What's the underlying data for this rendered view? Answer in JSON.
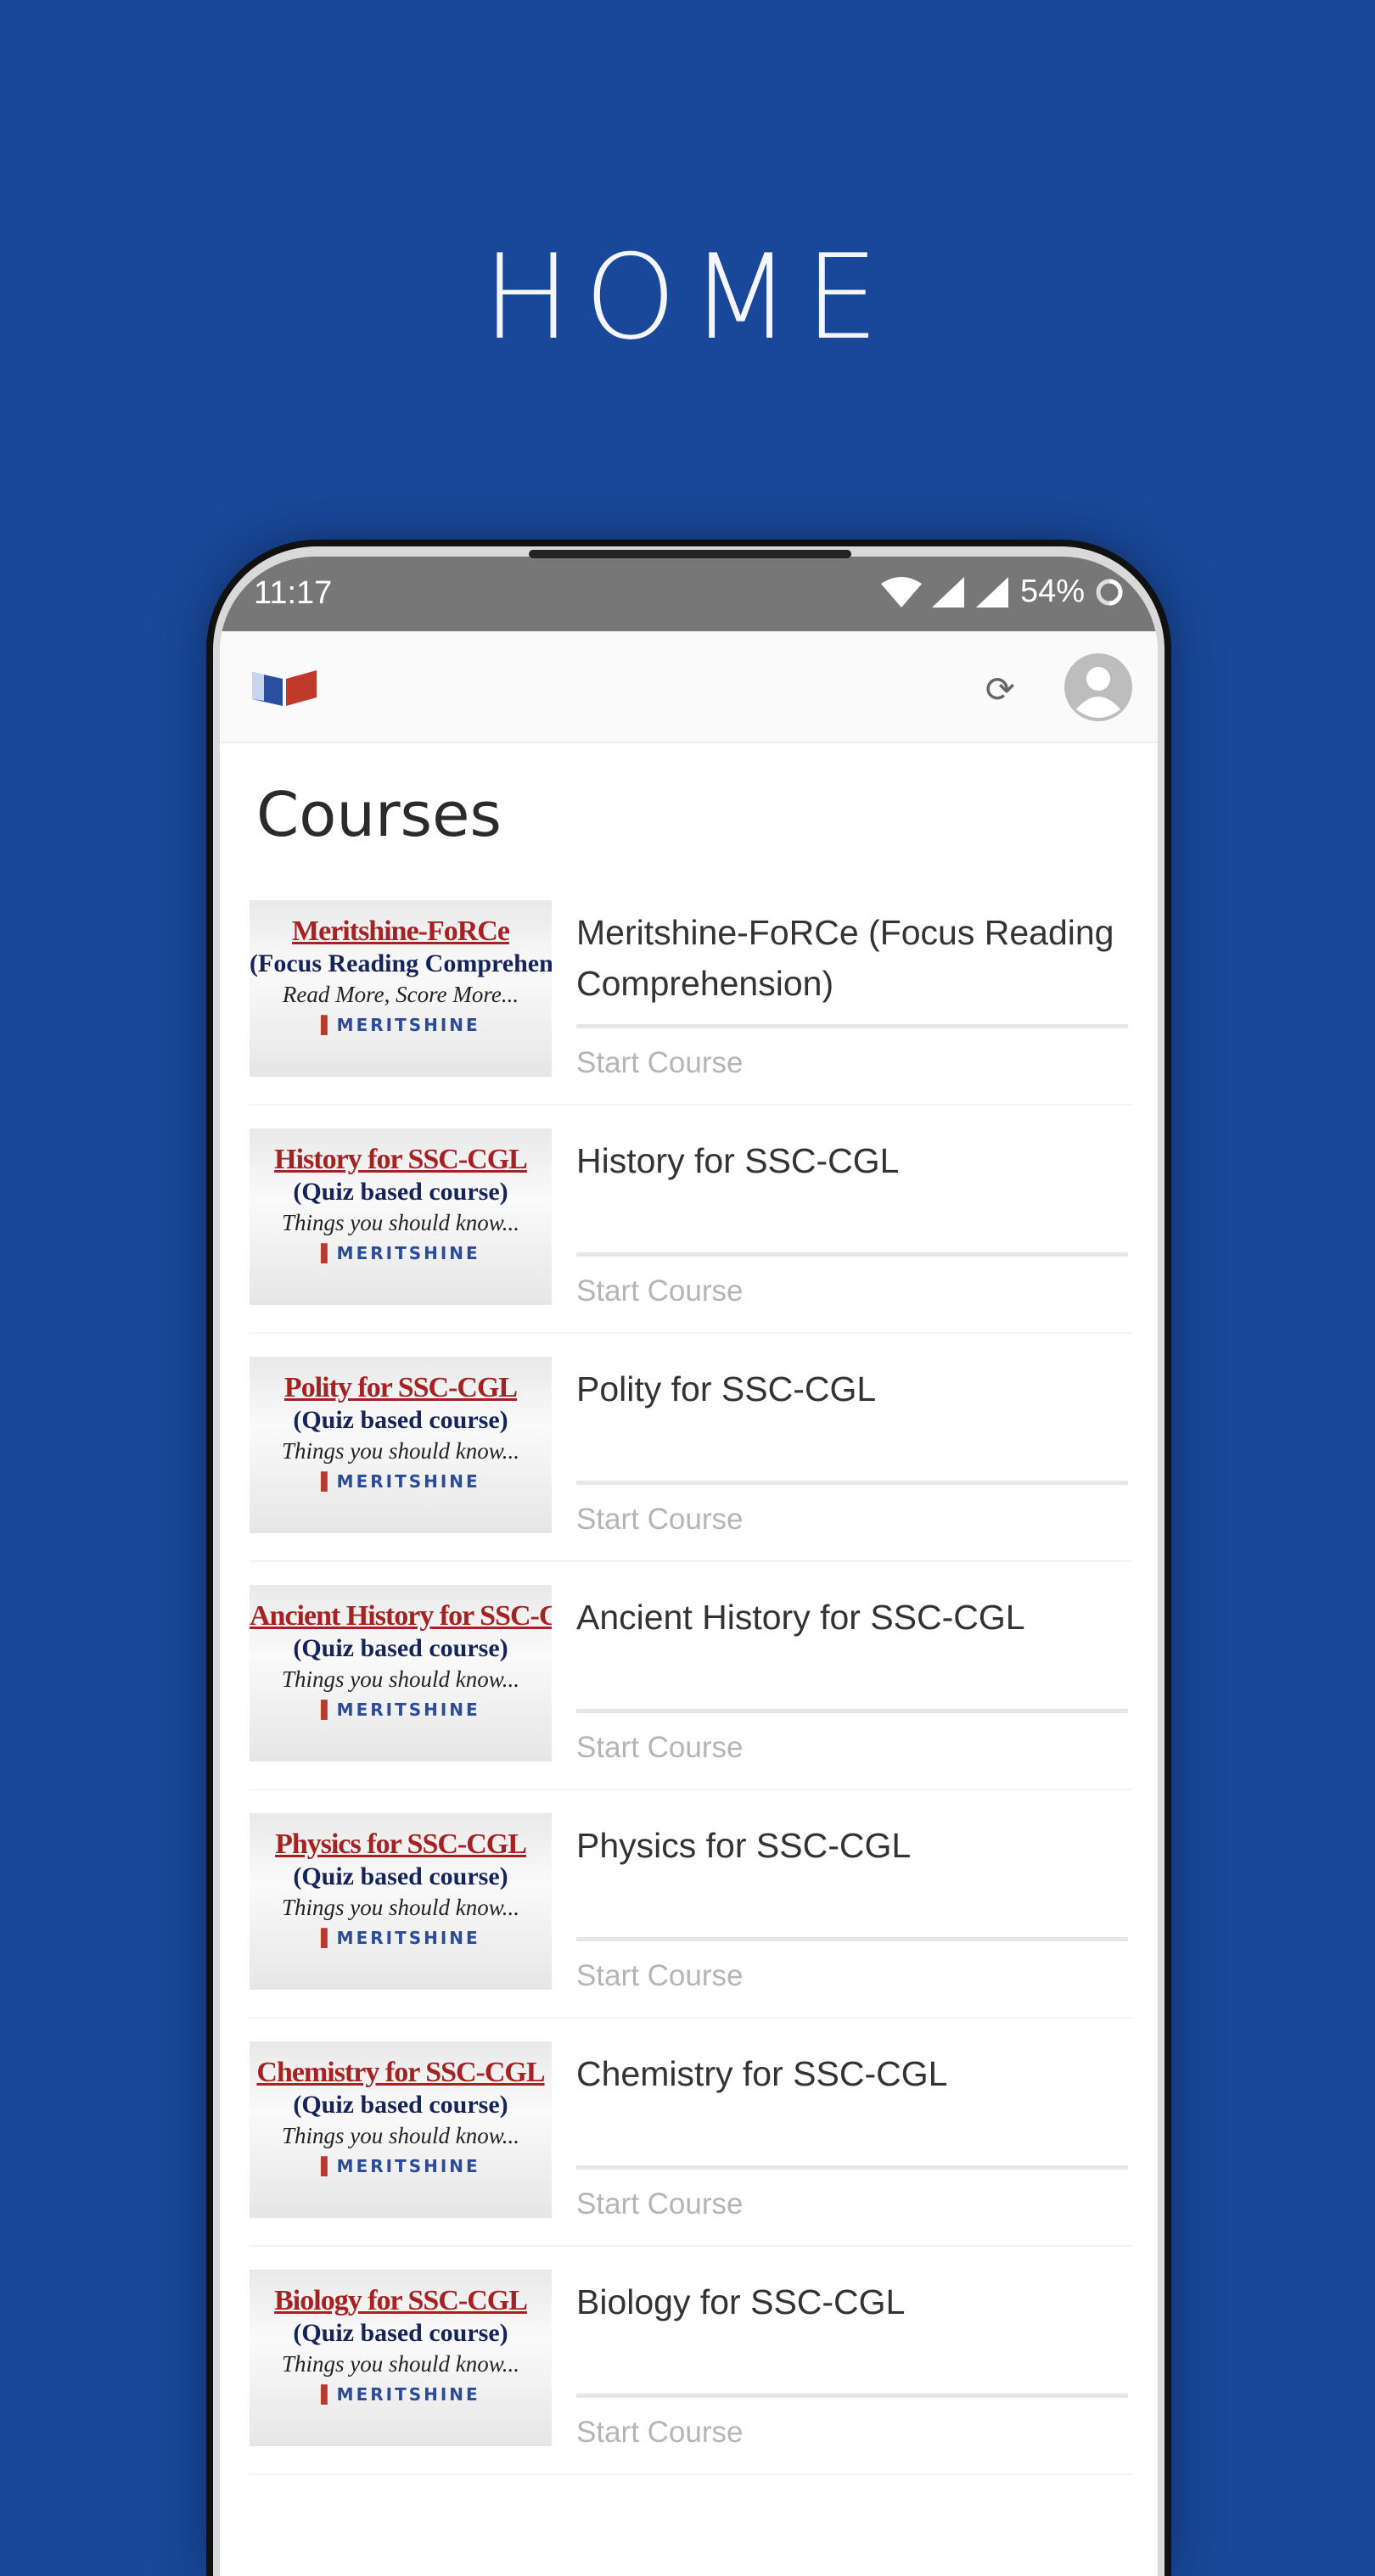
{
  "banner_title": "HOME",
  "status_bar": {
    "time": "11:17",
    "battery": "54%"
  },
  "page_title": "Courses",
  "courses": [
    {
      "title": "Meritshine-FoRCe (Focus Reading Comprehension)",
      "action": "Start Course",
      "thumb": {
        "line1": "Meritshine-FoRCe",
        "line2": "(Focus Reading Comprehension)",
        "line3": "Read More, Score More...",
        "logo": "MERITSHINE"
      }
    },
    {
      "title": "History for SSC-CGL",
      "action": "Start Course",
      "thumb": {
        "line1": "History for SSC-CGL",
        "line2": "(Quiz based course)",
        "line3": "Things you should know...",
        "logo": "MERITSHINE"
      }
    },
    {
      "title": "Polity for SSC-CGL",
      "action": "Start Course",
      "thumb": {
        "line1": "Polity for SSC-CGL",
        "line2": "(Quiz based course)",
        "line3": "Things you should know...",
        "logo": "MERITSHINE"
      }
    },
    {
      "title": "Ancient History for SSC-CGL",
      "action": "Start Course",
      "thumb": {
        "line1": "Ancient History for SSC-CGL",
        "line2": "(Quiz based course)",
        "line3": "Things you should know...",
        "logo": "MERITSHINE"
      }
    },
    {
      "title": "Physics for SSC-CGL",
      "action": "Start Course",
      "thumb": {
        "line1": "Physics for SSC-CGL",
        "line2": "(Quiz based course)",
        "line3": "Things you should know...",
        "logo": "MERITSHINE"
      }
    },
    {
      "title": "Chemistry for SSC-CGL",
      "action": "Start Course",
      "thumb": {
        "line1": "Chemistry for SSC-CGL",
        "line2": "(Quiz based course)",
        "line3": "Things you should know...",
        "logo": "MERITSHINE"
      }
    },
    {
      "title": "Biology for SSC-CGL",
      "action": "Start Course",
      "thumb": {
        "line1": "Biology for SSC-CGL",
        "line2": "(Quiz based course)",
        "line3": "Things you should know...",
        "logo": "MERITSHINE"
      }
    }
  ],
  "colors": {
    "background": "#19489a",
    "status_bar": "#777777",
    "thumb_title": "#a52222",
    "thumb_subtitle": "#14245a"
  },
  "icons": {
    "app_logo": "book-logo-icon",
    "refresh": "refresh-icon",
    "profile": "account-circle-icon",
    "wifi": "wifi-icon",
    "signal": "signal-icon",
    "battery": "battery-icon"
  }
}
